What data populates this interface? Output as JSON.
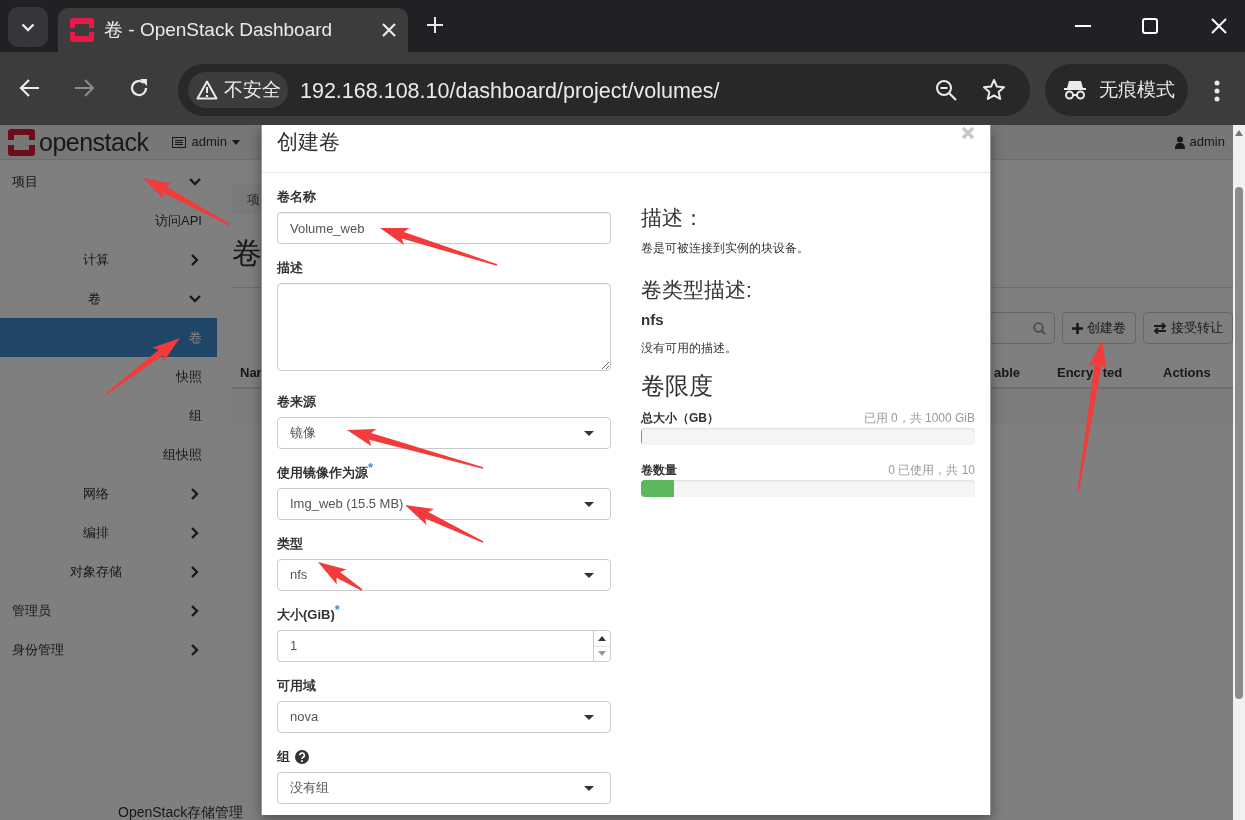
{
  "browser": {
    "tab_title": "卷 - OpenStack Dashboard",
    "security_label": "不安全",
    "url": "192.168.108.10/dashboard/project/volumes/",
    "incognito_label": "无痕模式"
  },
  "topbar": {
    "logo_text": "openstack",
    "project_menu": "admin",
    "user_menu": "admin"
  },
  "sidebar": {
    "items": [
      {
        "label": "项目",
        "expanded": true,
        "selected": false,
        "children": [
          {
            "label": "访问API",
            "selected": false
          },
          {
            "label": "计算",
            "expanded": false,
            "selected": false
          },
          {
            "label": "卷",
            "expanded": true,
            "selected": false,
            "children": [
              {
                "label": "卷",
                "selected": true
              },
              {
                "label": "快照",
                "selected": false
              },
              {
                "label": "组",
                "selected": false
              },
              {
                "label": "组快照",
                "selected": false
              }
            ]
          },
          {
            "label": "网络",
            "expanded": false,
            "selected": false
          },
          {
            "label": "编排",
            "expanded": false,
            "selected": false
          },
          {
            "label": "对象存储",
            "expanded": false,
            "selected": false
          }
        ]
      },
      {
        "label": "管理员",
        "expanded": false,
        "selected": false
      },
      {
        "label": "身份管理",
        "expanded": false,
        "selected": false
      }
    ]
  },
  "content": {
    "breadcrumb": "项",
    "heading": "卷",
    "buttons": [
      {
        "kind": "create",
        "label": "创建卷"
      },
      {
        "kind": "transfer",
        "label": "接受转让"
      }
    ],
    "table": {
      "columns": [
        "Nar",
        "able",
        "Encry ted",
        "Actions"
      ]
    },
    "footer_text": "OpenStack存储管理"
  },
  "modal": {
    "title": "创建卷",
    "fields": [
      {
        "kind": "text",
        "label": "卷名称",
        "value": "Volume_web"
      },
      {
        "kind": "textarea",
        "label": "描述"
      },
      {
        "kind": "select",
        "label": "卷来源",
        "value": "镜像"
      },
      {
        "kind": "select",
        "label": "使用镜像作为源",
        "required_mark": "*",
        "value": "Img_web (15.5 MB)"
      },
      {
        "kind": "select",
        "label": "类型",
        "value": "nfs"
      },
      {
        "kind": "number",
        "label": "大小(GiB)",
        "required_mark": "*",
        "value": "1"
      },
      {
        "kind": "select",
        "label": "可用域",
        "value": "nova"
      },
      {
        "kind": "select",
        "label": "组",
        "help": true,
        "value": "没有组"
      }
    ],
    "info": {
      "heading": "描述：",
      "text": "卷是可被连接到实例的块设备。",
      "type_heading": "卷类型描述:",
      "type_name": "nfs",
      "type_text": "没有可用的描述。",
      "limits_heading": "卷限度",
      "limits": [
        {
          "label": "总大小（GB）",
          "reading": "已用 0，共 1000 GiB",
          "level": 0.004
        },
        {
          "label": "卷数量",
          "reading": "0 已使用，共 10",
          "level": 0.1
        }
      ]
    }
  }
}
